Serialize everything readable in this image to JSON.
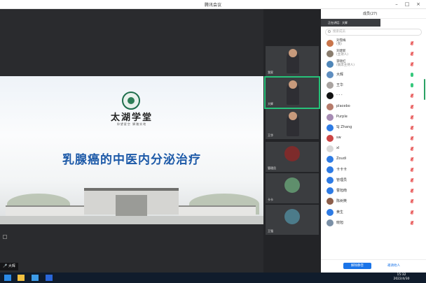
{
  "window": {
    "title": "腾讯会议"
  },
  "slide": {
    "school_name": "太湖学堂",
    "motto": "仰望星空 脚踏实地",
    "headline": "乳腺癌的中医内分泌治疗"
  },
  "speaker": {
    "label": "大辉"
  },
  "gallery": [
    {
      "caption": "我家"
    },
    {
      "caption": "大辉"
    },
    {
      "caption": "王华"
    },
    {
      "caption": "管理员"
    },
    {
      "caption": "卡卡"
    },
    {
      "caption": "王强"
    }
  ],
  "panel": {
    "title": "成员(27)",
    "notice": "正在讲话：大辉",
    "search_placeholder": "搜索成员",
    "members": [
      {
        "name": "刘雪梅",
        "sub": "(我)",
        "color": "#c9754a",
        "mic": "off"
      },
      {
        "name": "刘建新",
        "sub": "(主持人)",
        "color": "#8a7d6e",
        "mic": "off"
      },
      {
        "name": "李晓红",
        "sub": "(联席主持人)",
        "color": "#4f86b8",
        "mic": "off"
      },
      {
        "name": "大辉",
        "sub": "",
        "color": "#5f8ec0",
        "mic": "on"
      },
      {
        "name": "王华",
        "sub": "",
        "color": "#a9a3a0",
        "mic": "on"
      },
      {
        "name": "- - -",
        "sub": "",
        "color": "#111111",
        "mic": "off"
      },
      {
        "name": "placebo",
        "sub": "",
        "color": "#b57a6a",
        "mic": "off"
      },
      {
        "name": "Purple",
        "sub": "",
        "color": "#a68bb3",
        "mic": "off"
      },
      {
        "name": "SJ Zhang",
        "sub": "",
        "color": "#2e7be4",
        "mic": "off"
      },
      {
        "name": "sw",
        "sub": "",
        "color": "#cc4444",
        "mic": "off"
      },
      {
        "name": "xl",
        "sub": "",
        "color": "#d8d8d8",
        "mic": "off"
      },
      {
        "name": "Zoudi",
        "sub": "",
        "color": "#2e7be4",
        "mic": "off"
      },
      {
        "name": "卡卡卡",
        "sub": "",
        "color": "#2e7be4",
        "mic": "off"
      },
      {
        "name": "管理员",
        "sub": "",
        "color": "#2e7be4",
        "mic": "off"
      },
      {
        "name": "曹旭南",
        "sub": "",
        "color": "#2e7be4",
        "mic": "off"
      },
      {
        "name": "陈树英",
        "sub": "",
        "color": "#8c5e4a",
        "mic": "off"
      },
      {
        "name": "黄生",
        "sub": "",
        "color": "#2e7be4",
        "mic": "off"
      },
      {
        "name": "晓旭",
        "sub": "",
        "color": "#7a8fa6",
        "mic": "off"
      }
    ],
    "primary_button": "解除静音",
    "link_button": "邀请他人"
  },
  "clock": {
    "time": "15:32",
    "date": "2022/4/30"
  }
}
